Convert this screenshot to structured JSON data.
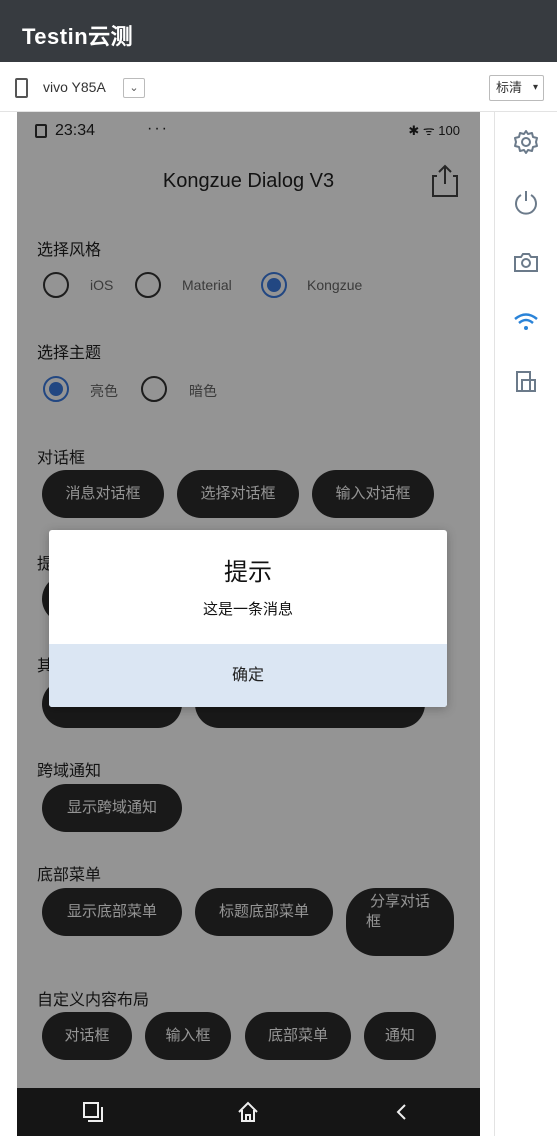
{
  "header": {
    "brand": "Testin云测"
  },
  "device": {
    "name": "vivo Y85A",
    "dropdown_glyph": "⌄",
    "quality": "标清",
    "quality_caret": "▾"
  },
  "status": {
    "time": "23:34",
    "dots": "···",
    "right": "✱ ᯤ 100"
  },
  "app": {
    "title": "Kongzue Dialog V3",
    "style_section": "选择风格",
    "style_options": [
      "iOS",
      "Material",
      "Kongzue"
    ],
    "style_selected": "Kongzue",
    "theme_section": "选择主题",
    "theme_options": [
      "亮色",
      "暗色"
    ],
    "theme_selected": "亮色",
    "dialog_section": "对话框",
    "dialog_buttons": [
      "消息对话框",
      "选择对话框",
      "输入对话框"
    ],
    "prompt_section_partial": "提",
    "other_section_partial": "其",
    "cross_section": "跨域通知",
    "cross_button": "显示跨域通知",
    "bottom_section": "底部菜单",
    "bottom_buttons": [
      "显示底部菜单",
      "标题底部菜单",
      "分享对话",
      "框"
    ],
    "custom_section": "自定义内容布局",
    "custom_buttons": [
      "对话框",
      "输入框",
      "底部菜单",
      "通知"
    ]
  },
  "dialog": {
    "title": "提示",
    "message": "这是一条消息",
    "ok": "确定"
  },
  "navbar": {
    "recent": "▢",
    "home": "⌂",
    "back": "‹"
  },
  "colors": {
    "accent": "#3c7be0",
    "topbar": "#373b40",
    "dialog_button_bg": "#dbe6f3"
  }
}
